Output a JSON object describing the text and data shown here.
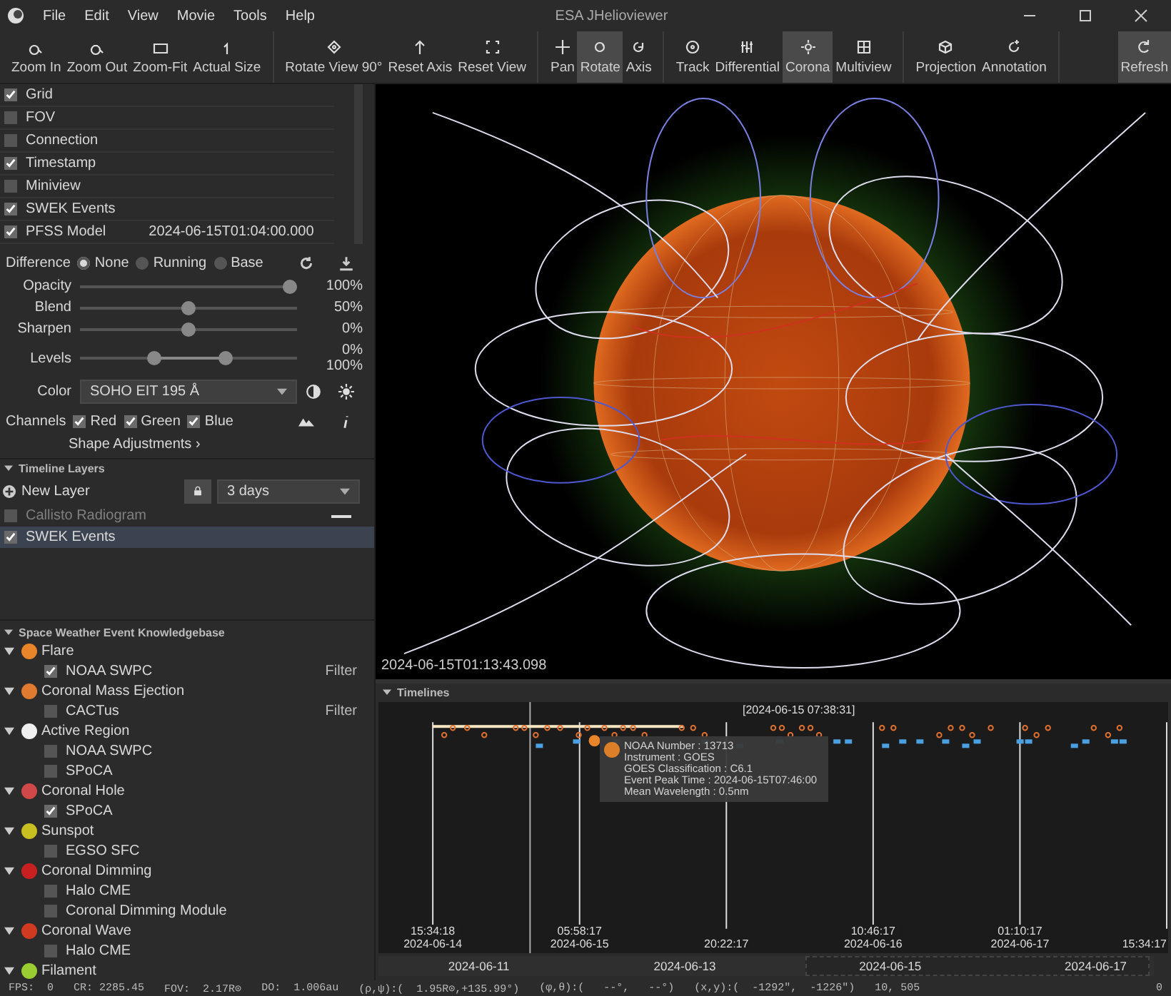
{
  "window": {
    "title": "ESA JHelioviewer"
  },
  "menu": [
    "File",
    "Edit",
    "View",
    "Movie",
    "Tools",
    "Help"
  ],
  "toolbar": {
    "groups": [
      {
        "buttons": [
          {
            "label": "Zoom In",
            "selected": false
          },
          {
            "label": "Zoom Out",
            "selected": false
          },
          {
            "label": "Zoom-Fit",
            "selected": false
          },
          {
            "label": "Actual Size",
            "selected": false
          }
        ]
      },
      {
        "buttons": [
          {
            "label": "Rotate View 90°",
            "selected": false
          },
          {
            "label": "Reset Axis",
            "selected": false
          },
          {
            "label": "Reset View",
            "selected": false
          }
        ]
      },
      {
        "buttons": [
          {
            "label": "Pan",
            "selected": false
          },
          {
            "label": "Rotate",
            "selected": true
          },
          {
            "label": "Axis",
            "selected": false
          }
        ]
      },
      {
        "buttons": [
          {
            "label": "Track",
            "selected": false
          },
          {
            "label": "Differential",
            "selected": false
          },
          {
            "label": "Corona",
            "selected": true
          },
          {
            "label": "Multiview",
            "selected": false
          }
        ]
      },
      {
        "buttons": [
          {
            "label": "Projection",
            "selected": false
          },
          {
            "label": "Annotation",
            "selected": false
          }
        ]
      },
      {
        "buttons": [
          {
            "label": "Refresh",
            "selected": true
          }
        ]
      }
    ]
  },
  "layers": [
    {
      "label": "Grid",
      "checked": true
    },
    {
      "label": "FOV",
      "checked": false
    },
    {
      "label": "Connection",
      "checked": false
    },
    {
      "label": "Timestamp",
      "checked": true
    },
    {
      "label": "Miniview",
      "checked": false
    },
    {
      "label": "SWEK Events",
      "checked": true
    },
    {
      "label": "PFSS Model",
      "checked": true,
      "time": "2024-06-15T01:04:00.000"
    }
  ],
  "adjustments": {
    "difference_label": "Difference",
    "difference": [
      {
        "label": "None",
        "selected": true
      },
      {
        "label": "Running",
        "selected": false
      },
      {
        "label": "Base",
        "selected": false
      }
    ],
    "sliders": [
      {
        "label": "Opacity",
        "level": 1,
        "reading": "100%"
      },
      {
        "label": "Blend",
        "level": 0.5,
        "reading": "50%"
      },
      {
        "label": "Sharpen",
        "level": 0.5,
        "reading": "0%"
      }
    ],
    "levels": {
      "label": "Levels",
      "low": {
        "level": 0.33,
        "reading": "0%"
      },
      "high": {
        "level": 0.68,
        "reading": "100%"
      }
    },
    "color_label": "Color",
    "color_value": "SOHO EIT 195 Å",
    "channels_label": "Channels",
    "channels": [
      {
        "label": "Red",
        "checked": true
      },
      {
        "label": "Green",
        "checked": true
      },
      {
        "label": "Blue",
        "checked": true
      }
    ],
    "shape_link": "Shape Adjustments ›"
  },
  "timeline_layers": {
    "title": "Timeline Layers",
    "new_layer": "New Layer",
    "range": "3 days",
    "rows": [
      {
        "label": "Callisto Radiogram",
        "checked": false,
        "disabled": true,
        "selected": false
      },
      {
        "label": "SWEK Events",
        "checked": true,
        "disabled": false,
        "selected": true
      }
    ]
  },
  "swek": {
    "title": "Space Weather Event Knowledgebase",
    "categories": [
      {
        "label": "Flare",
        "expanded": true,
        "color": "#e8842a",
        "children": [
          {
            "label": "NOAA SWPC",
            "checked": true,
            "filter": "Filter"
          }
        ]
      },
      {
        "label": "Coronal Mass Ejection",
        "expanded": true,
        "color": "#e07a30",
        "children": [
          {
            "label": "CACTus",
            "checked": false,
            "filter": "Filter"
          }
        ]
      },
      {
        "label": "Active Region",
        "expanded": true,
        "color": "#f0f0f0",
        "children": [
          {
            "label": "NOAA SWPC",
            "checked": false
          },
          {
            "label": "SPoCA",
            "checked": false
          }
        ]
      },
      {
        "label": "Coronal Hole",
        "expanded": true,
        "color": "#d04848",
        "children": [
          {
            "label": "SPoCA",
            "checked": true
          }
        ]
      },
      {
        "label": "Sunspot",
        "expanded": true,
        "color": "#c8c020",
        "children": [
          {
            "label": "EGSO SFC",
            "checked": false
          }
        ]
      },
      {
        "label": "Coronal Dimming",
        "expanded": true,
        "color": "#c82020",
        "children": [
          {
            "label": "Halo CME",
            "checked": false
          },
          {
            "label": "Coronal Dimming Module",
            "checked": false
          }
        ]
      },
      {
        "label": "Coronal Wave",
        "expanded": true,
        "color": "#d03a20",
        "children": [
          {
            "label": "Halo CME",
            "checked": false
          }
        ]
      },
      {
        "label": "Filament",
        "expanded": true,
        "color": "#9acd32"
      }
    ]
  },
  "view": {
    "timestamp": "2024-06-15T01:13:43.098"
  },
  "timelines": {
    "title": "Timelines",
    "cursor": "[2024-06-15 07:38:31]",
    "ticks": [
      {
        "time": "15:34:18",
        "date": "2024-06-14"
      },
      {
        "time": "05:58:17",
        "date": "2024-06-15"
      },
      {
        "time": "20:22:17"
      },
      {
        "time": "10:46:17",
        "date": "2024-06-16"
      },
      {
        "time": "01:10:17",
        "date": "2024-06-17"
      },
      {
        "time": "15:34:17"
      }
    ],
    "tooltip": [
      "NOAA Number : 13713",
      "Instrument : GOES",
      "GOES Classification : C6.1",
      "Event Peak Time : 2024-06-15T07:46:00",
      "Mean Wavelength : 0.5nm"
    ],
    "range_dates": [
      "2024-06-11",
      "2024-06-13",
      "2024-06-15",
      "2024-06-17"
    ]
  },
  "status_bar": [
    "FPS:  0",
    "CR: 2285.45",
    "FOV:  2.17R⊙",
    "DO:  1.006au",
    "(ρ,ψ):(  1.95R⊙,+135.99°)",
    "(φ,θ):(   --°,   --°)",
    "(x,y):(  -1292″,  -1226″)",
    "10, 505",
    "0"
  ]
}
